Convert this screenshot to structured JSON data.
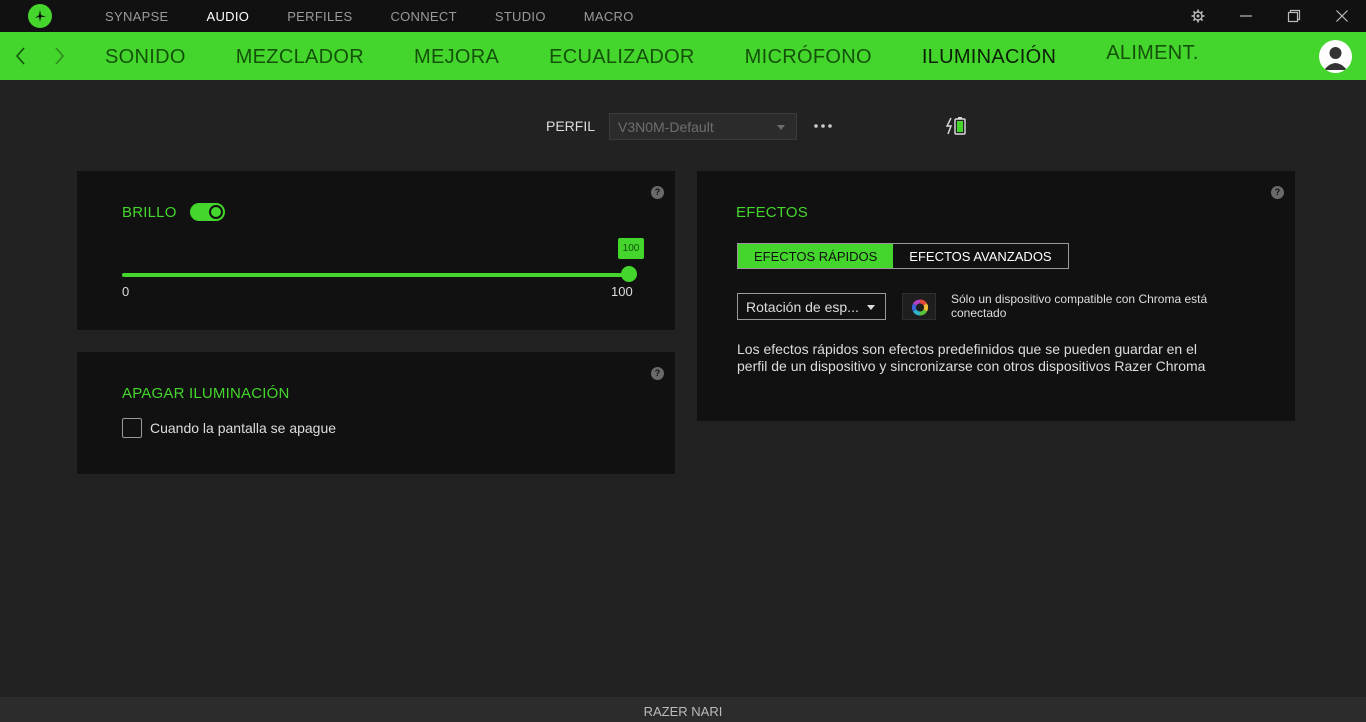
{
  "topnav": {
    "items": [
      {
        "label": "SYNAPSE",
        "active": false
      },
      {
        "label": "AUDIO",
        "active": true
      },
      {
        "label": "PERFILES",
        "active": false
      },
      {
        "label": "CONNECT",
        "active": false
      },
      {
        "label": "STUDIO",
        "active": false
      },
      {
        "label": "MACRO",
        "active": false
      }
    ]
  },
  "subnav": {
    "items": [
      {
        "label": "SONIDO"
      },
      {
        "label": "MEZCLADOR"
      },
      {
        "label": "MEJORA"
      },
      {
        "label": "ECUALIZADOR"
      },
      {
        "label": "MICRÓFONO"
      },
      {
        "label": "ILUMINACIÓN",
        "active": true
      },
      {
        "label": "ALIMENT."
      }
    ]
  },
  "profile": {
    "label": "PERFIL",
    "value": "V3N0M-Default"
  },
  "brightness": {
    "title": "BRILLO",
    "enabled": true,
    "value": "100",
    "min": "0",
    "max": "100",
    "help": "?"
  },
  "lighting_off": {
    "title": "APAGAR ILUMINACIÓN",
    "checkbox_label": "Cuando la pantalla se apague",
    "checked": false,
    "help": "?"
  },
  "effects": {
    "title": "EFECTOS",
    "tabs": [
      {
        "label": "EFECTOS RÁPIDOS",
        "active": true
      },
      {
        "label": "EFECTOS AVANZADOS",
        "active": false
      }
    ],
    "selected_effect": "Rotación de esp...",
    "chroma_note": "Sólo un dispositivo compatible con Chroma está conectado",
    "description": "Los efectos rápidos son efectos predefinidos que se pueden guardar en el perfil de un dispositivo y sincronizarse con otros dispositivos Razer Chroma",
    "help": "?"
  },
  "footer": {
    "device": "RAZER NARI"
  },
  "colors": {
    "accent": "#44d62c",
    "background": "#222222",
    "panel": "#111111"
  }
}
